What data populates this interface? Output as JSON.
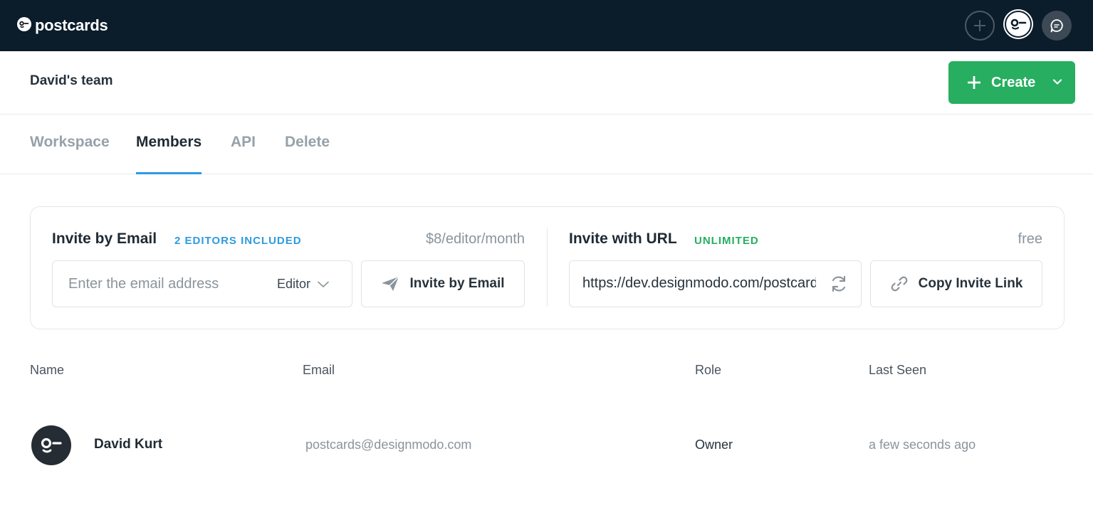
{
  "app": {
    "brand": "postcards"
  },
  "header": {
    "team_name": "David's team",
    "create_label": "Create"
  },
  "tabs": [
    {
      "label": "Workspace",
      "active": false
    },
    {
      "label": "Members",
      "active": true
    },
    {
      "label": "API",
      "active": false
    },
    {
      "label": "Delete",
      "active": false
    }
  ],
  "invite_email": {
    "title": "Invite by Email",
    "badge": "2 EDITORS INCLUDED",
    "price": "$8/editor/month",
    "placeholder": "Enter the email address",
    "role": "Editor",
    "button_label": "Invite by Email"
  },
  "invite_url": {
    "title": "Invite with URL",
    "badge": "UNLIMITED",
    "price": "free",
    "url": "https://dev.designmodo.com/postcards/invite",
    "button_label": "Copy Invite Link"
  },
  "table": {
    "headers": {
      "name": "Name",
      "email": "Email",
      "role": "Role",
      "last_seen": "Last Seen"
    },
    "rows": [
      {
        "name": "David Kurt",
        "email": "postcards@designmodo.com",
        "role": "Owner",
        "last_seen": "a few seconds ago"
      }
    ]
  },
  "colors": {
    "topbar": "#0b1c2a",
    "accent_green": "#27ae60",
    "accent_blue": "#2d9be0"
  },
  "icons": [
    "logo-icon",
    "plus-icon",
    "avatar-icon",
    "chat-icon",
    "chevron-down-icon",
    "send-icon",
    "refresh-icon",
    "link-icon"
  ]
}
